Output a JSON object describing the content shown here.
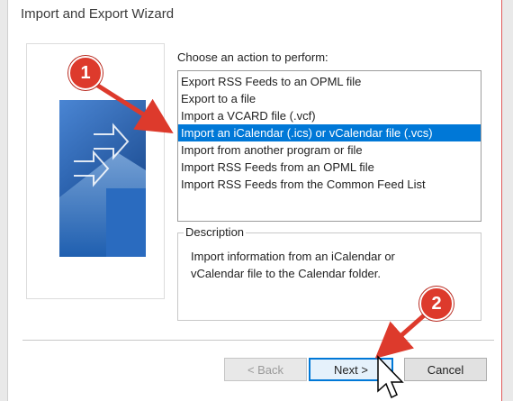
{
  "window": {
    "title": "Import and Export Wizard"
  },
  "prompt": "Choose an action to perform:",
  "actions": [
    {
      "label": "Export RSS Feeds to an OPML file",
      "selected": false
    },
    {
      "label": "Export to a file",
      "selected": false
    },
    {
      "label": "Import a VCARD file (.vcf)",
      "selected": false
    },
    {
      "label": "Import an iCalendar (.ics) or vCalendar file (.vcs)",
      "selected": true
    },
    {
      "label": "Import from another program or file",
      "selected": false
    },
    {
      "label": "Import RSS Feeds from an OPML file",
      "selected": false
    },
    {
      "label": "Import RSS Feeds from the Common Feed List",
      "selected": false
    }
  ],
  "description": {
    "legend": "Description",
    "line1": "Import information from an iCalendar or",
    "line2": "vCalendar file to the Calendar folder."
  },
  "buttons": {
    "back": "< Back",
    "next": "Next >",
    "cancel": "Cancel"
  },
  "annotations": {
    "badge1": "1",
    "badge2": "2"
  },
  "colors": {
    "selection": "#0078d7",
    "annotation_red": "#dd3a2c",
    "default_button_border": "#0078d7"
  },
  "icons": [
    "wizard-illustration",
    "annotation-arrow",
    "mouse-cursor-icon"
  ]
}
